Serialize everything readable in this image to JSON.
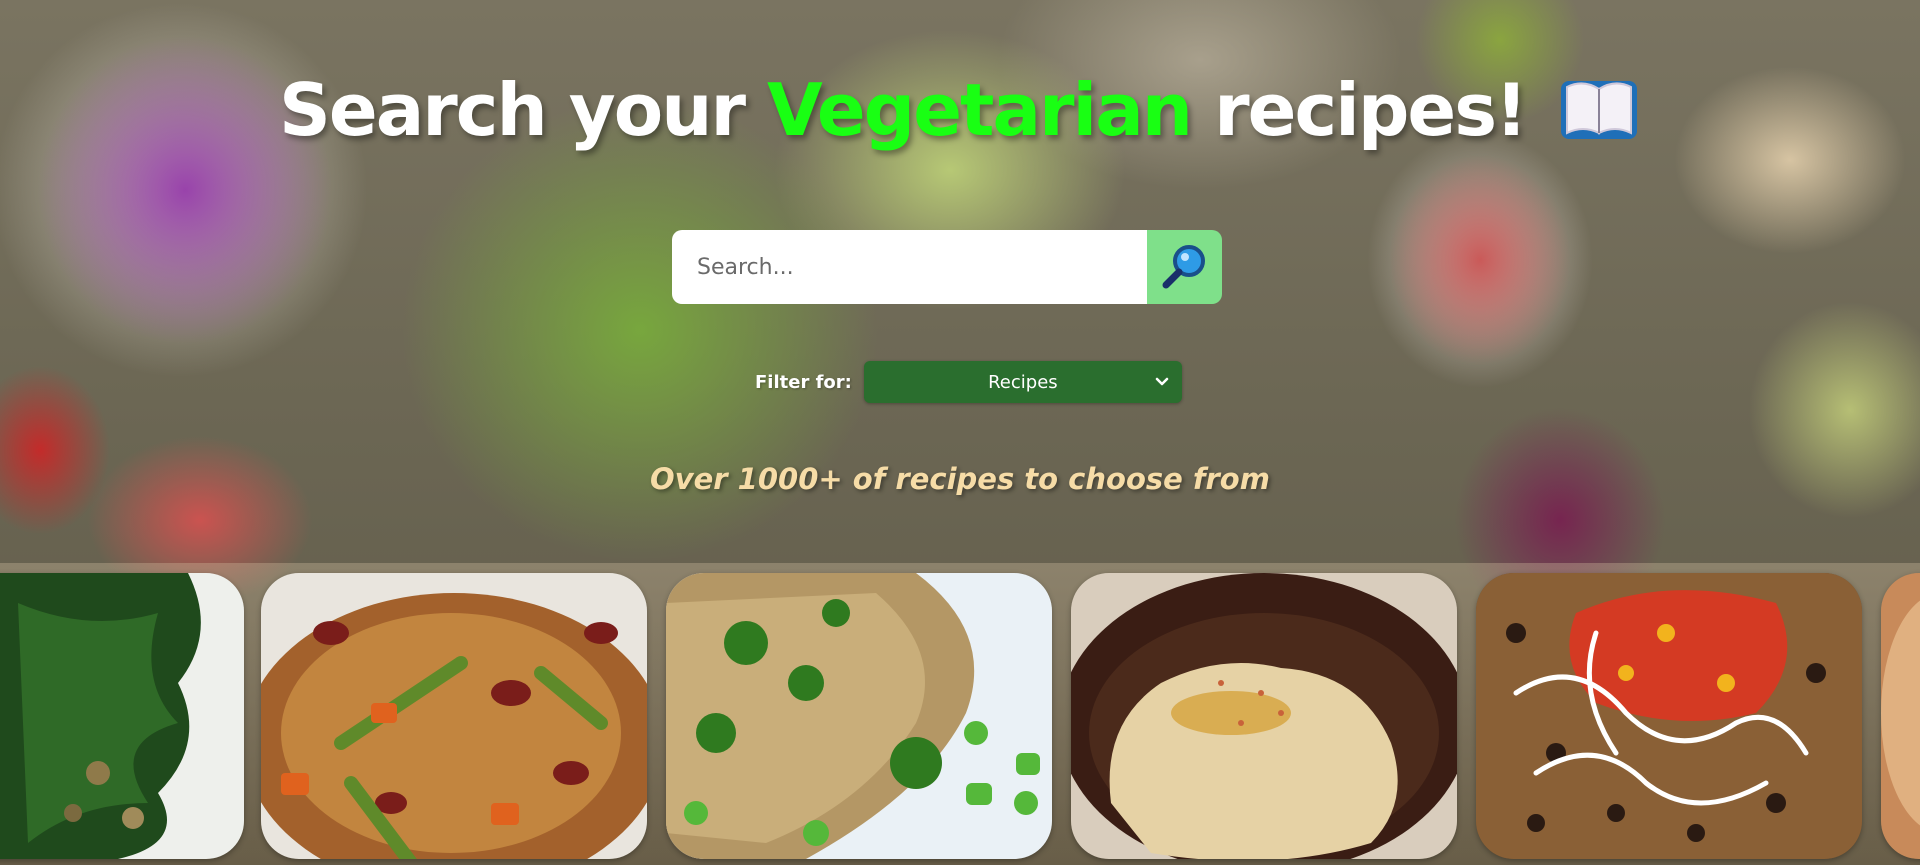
{
  "hero": {
    "title_part1": "Search your ",
    "title_accent": "Vegetarian",
    "title_part2": " recipes!",
    "accent_color": "#19ff13",
    "title_icon": "open-book-icon"
  },
  "search": {
    "placeholder": "Search...",
    "button_icon": "magnifying-glass-icon",
    "button_color": "#7fe08a"
  },
  "filter": {
    "label": "Filter for:",
    "selected": "Recipes",
    "select_color": "#2a6e2e"
  },
  "tagline": "Over 1000+ of recipes to choose from",
  "carousel": {
    "cards": [
      {
        "dish": "sauteed-kale"
      },
      {
        "dish": "bean-rice-stew"
      },
      {
        "dish": "broccoli-fried-rice"
      },
      {
        "dish": "hummus"
      },
      {
        "dish": "rice-bean-salsa-bowl"
      },
      {
        "dish": "partial-card"
      }
    ]
  }
}
